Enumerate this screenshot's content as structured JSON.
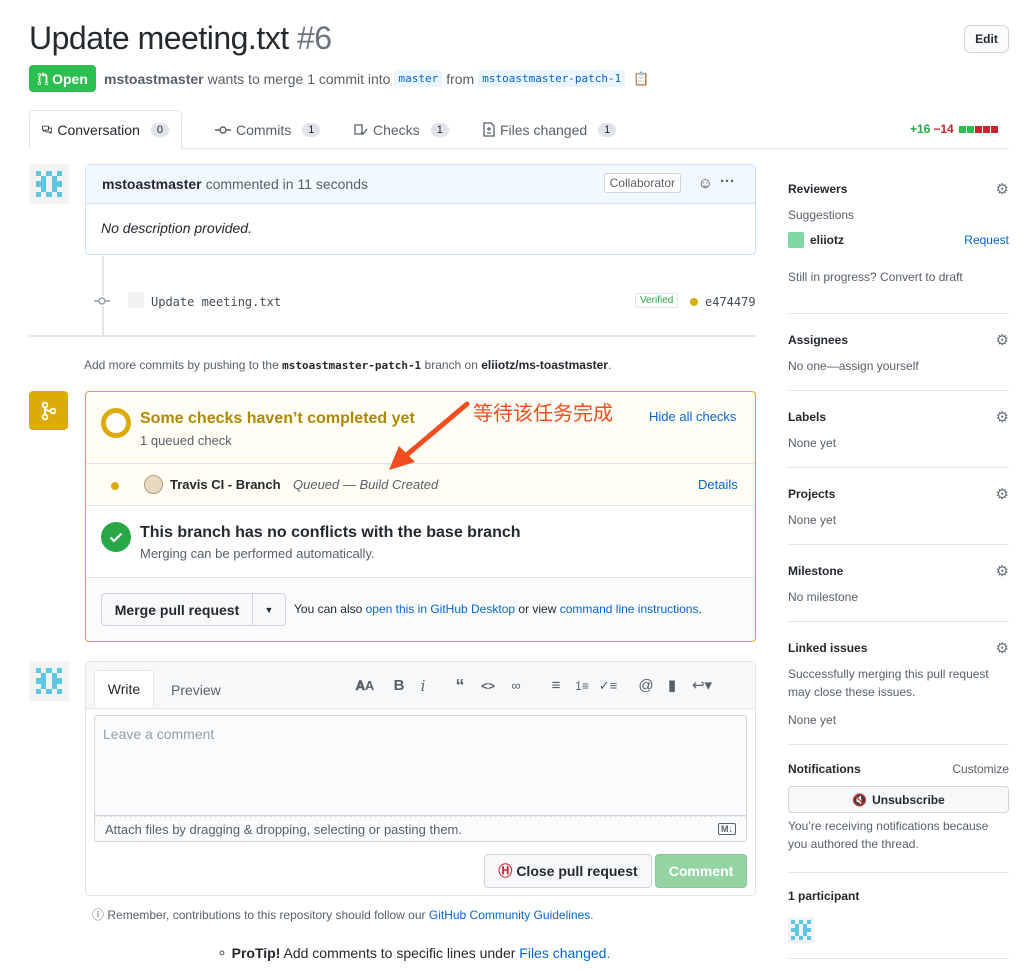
{
  "header": {
    "title": "Update meeting.txt",
    "number": "#6",
    "edit_label": "Edit",
    "state_label": "Open",
    "author": "mstoastmaster",
    "merge_text": "wants to merge 1 commit into",
    "base_branch": "master",
    "from_text": "from",
    "head_branch": "mstoastmaster-patch-1"
  },
  "tabs": [
    {
      "label": "Conversation",
      "count": "0",
      "icon": "comment-discussion-icon"
    },
    {
      "label": "Commits",
      "count": "1",
      "icon": "git-commit-icon"
    },
    {
      "label": "Checks",
      "count": "1",
      "icon": "checklist-icon"
    },
    {
      "label": "Files changed",
      "count": "1",
      "icon": "file-diff-icon"
    }
  ],
  "diffstat": {
    "additions": "+16",
    "deletions": "−14",
    "colors": [
      "#2cbe4e",
      "#2cbe4e",
      "#cb2431",
      "#cb2431",
      "#cb2431"
    ]
  },
  "comment": {
    "author": "mstoastmaster",
    "time_text": "commented in 11 seconds",
    "badge": "Collaborator",
    "body": "No description provided."
  },
  "commit": {
    "message": "Update meeting.txt",
    "verified": "Verified",
    "sha": "e474479"
  },
  "push_note": {
    "prefix": "Add more commits by pushing to the",
    "branch": "mstoastmaster-patch-1",
    "mid": "branch on",
    "repo": "eliiotz/ms-toastmaster",
    "suffix": "."
  },
  "checks": {
    "title": "Some checks haven’t completed yet",
    "subtitle": "1 queued check",
    "toggle_label": "Hide all checks",
    "items": [
      {
        "name": "Travis CI - Branch",
        "status": "Queued — Build Created",
        "details": "Details"
      }
    ]
  },
  "conflicts": {
    "title": "This branch has no conflicts with the base branch",
    "subtitle": "Merging can be performed automatically."
  },
  "merge": {
    "button_label": "Merge pull request",
    "also_text": "You can also",
    "desktop_link": "open this in GitHub Desktop",
    "or_view": "or view",
    "cli_link": "command line instructions",
    "period": "."
  },
  "annotation": {
    "text": "等待该任务完成",
    "color": "#f24d21"
  },
  "composer": {
    "write_tab": "Write",
    "preview_tab": "Preview",
    "toolbar": [
      "AA",
      "B",
      "i",
      "“",
      "<>",
      "link",
      "ul",
      "ol",
      "task",
      "@",
      "bookmark",
      "reply"
    ],
    "placeholder": "Leave a comment",
    "attach_text": "Attach files by dragging & dropping, selecting or pasting them.",
    "close_label": "Close pull request",
    "comment_label": "Comment"
  },
  "footer": {
    "remember_prefix": "Remember, contributions to this repository should follow our",
    "guidelines_link": "GitHub Community Guidelines",
    "remember_suffix": ".",
    "protip_label": "ProTip!",
    "protip_text": "Add comments to specific lines under",
    "protip_link": "Files changed",
    "protip_suffix": "."
  },
  "sidebar": {
    "reviewers": {
      "title": "Reviewers",
      "suggestions": "Suggestions",
      "user": "eliiotz",
      "request": "Request",
      "draft_text": "Still in progress? Convert to draft"
    },
    "assignees": {
      "title": "Assignees",
      "value": "No one—assign yourself"
    },
    "labels": {
      "title": "Labels",
      "value": "None yet"
    },
    "projects": {
      "title": "Projects",
      "value": "None yet"
    },
    "milestone": {
      "title": "Milestone",
      "value": "No milestone"
    },
    "linked": {
      "title": "Linked issues",
      "desc": "Successfully merging this pull request may close these issues.",
      "value": "None yet"
    },
    "notifications": {
      "title": "Notifications",
      "customize": "Customize",
      "button": "Unsubscribe",
      "desc": "You’re receiving notifications because you authored the thread."
    },
    "participants": {
      "title": "1 participant"
    }
  }
}
